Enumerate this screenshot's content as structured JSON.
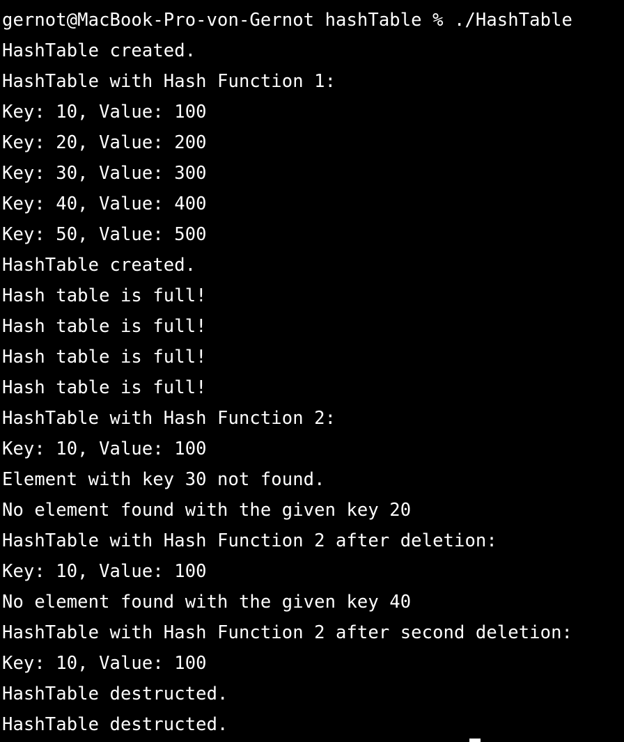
{
  "terminal": {
    "prompt": "gernot@MacBook-Pro-von-Gernot hashTable % ./HashTable",
    "lines": [
      "HashTable created.",
      "HashTable with Hash Function 1:",
      "Key: 10, Value: 100",
      "Key: 20, Value: 200",
      "Key: 30, Value: 300",
      "Key: 40, Value: 400",
      "Key: 50, Value: 500",
      "HashTable created.",
      "Hash table is full!",
      "Hash table is full!",
      "Hash table is full!",
      "Hash table is full!",
      "HashTable with Hash Function 2:",
      "Key: 10, Value: 100",
      "Element with key 30 not found.",
      "No element found with the given key 20",
      "HashTable with Hash Function 2 after deletion:",
      "Key: 10, Value: 100",
      "No element found with the given key 40",
      "HashTable with Hash Function 2 after second deletion:",
      "Key: 10, Value: 100",
      "HashTable destructed.",
      "HashTable destructed."
    ]
  },
  "colors": {
    "background": "#000000",
    "foreground": "#ffffff"
  }
}
